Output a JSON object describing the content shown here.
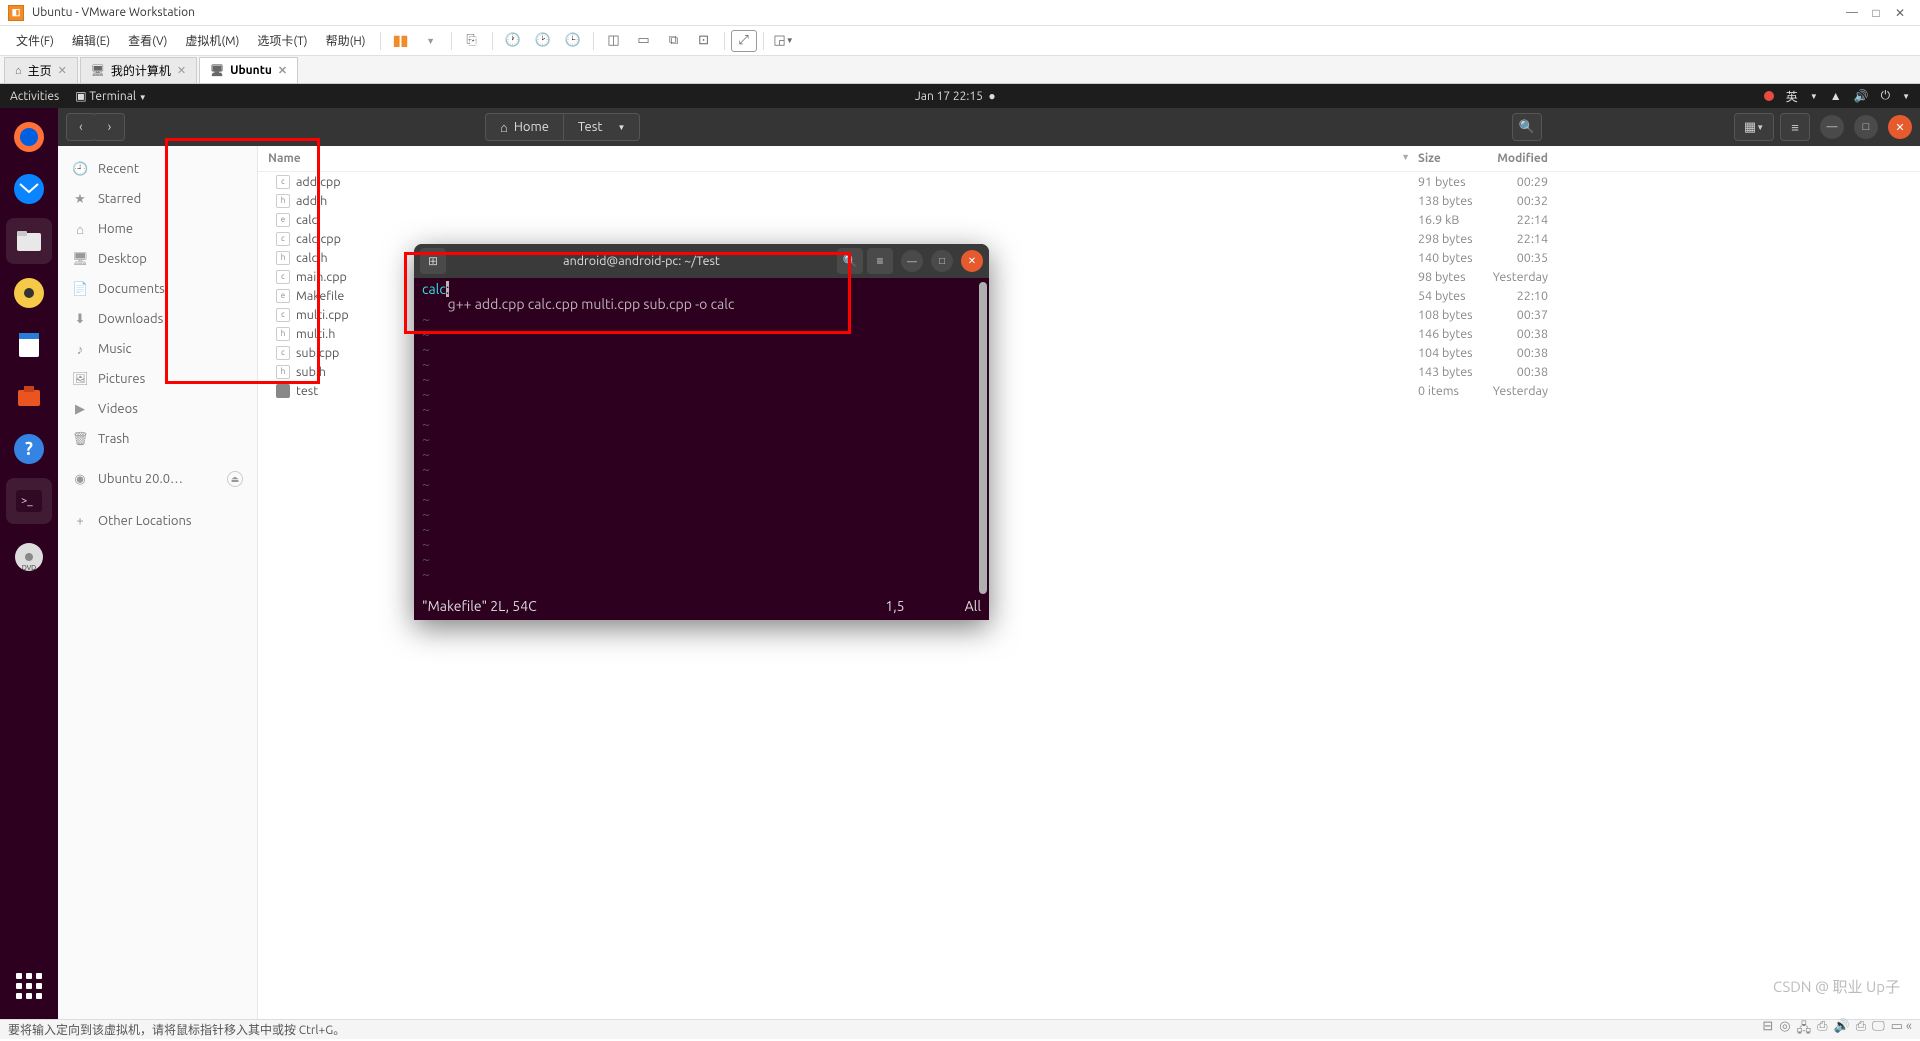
{
  "host": {
    "title": "Ubuntu - VMware Workstation",
    "menu": [
      "文件(F)",
      "编辑(E)",
      "查看(V)",
      "虚拟机(M)",
      "选项卡(T)",
      "帮助(H)"
    ],
    "tabs": [
      {
        "label": "主页",
        "icon": "⌂"
      },
      {
        "label": "我的计算机",
        "icon": "🖥"
      },
      {
        "label": "Ubuntu",
        "icon": "🖥",
        "active": true
      }
    ],
    "status": "要将输入定向到该虚拟机，请将鼠标指针移入其中或按 Ctrl+G。"
  },
  "ubuntu_panel": {
    "activities": "Activities",
    "terminal_menu": "Terminal",
    "datetime": "Jan 17  22:15",
    "lang": "英"
  },
  "files": {
    "path": [
      {
        "label": "Home",
        "icon": "⌂"
      },
      {
        "label": "Test",
        "dropdown": true
      }
    ],
    "sidebar": [
      {
        "label": "Recent",
        "icon": "🕘"
      },
      {
        "label": "Starred",
        "icon": "★"
      },
      {
        "label": "Home",
        "icon": "⌂"
      },
      {
        "label": "Desktop",
        "icon": "🖥"
      },
      {
        "label": "Documents",
        "icon": "📄"
      },
      {
        "label": "Downloads",
        "icon": "⬇"
      },
      {
        "label": "Music",
        "icon": "♪"
      },
      {
        "label": "Pictures",
        "icon": "🖼"
      },
      {
        "label": "Videos",
        "icon": "▶"
      },
      {
        "label": "Trash",
        "icon": "🗑"
      },
      {
        "label": "Ubuntu 20.0…",
        "icon": "◉",
        "eject": true
      },
      {
        "label": "Other Locations",
        "icon": "+"
      }
    ],
    "columns": {
      "name": "Name",
      "size": "Size",
      "modified": "Modified"
    },
    "rows": [
      {
        "name": "add.cpp",
        "type": "c",
        "size": "91 bytes",
        "modified": "00:29"
      },
      {
        "name": "add.h",
        "type": "h",
        "size": "138 bytes",
        "modified": "00:32"
      },
      {
        "name": "calc",
        "type": "e",
        "size": "16.9 kB",
        "modified": "22:14"
      },
      {
        "name": "calc.cpp",
        "type": "c",
        "size": "298 bytes",
        "modified": "22:14"
      },
      {
        "name": "calc.h",
        "type": "h",
        "size": "140 bytes",
        "modified": "00:35"
      },
      {
        "name": "main.cpp",
        "type": "c",
        "size": "98 bytes",
        "modified": "Yesterday"
      },
      {
        "name": "Makefile",
        "type": "e",
        "size": "54 bytes",
        "modified": "22:10"
      },
      {
        "name": "multi.cpp",
        "type": "c",
        "size": "108 bytes",
        "modified": "00:37"
      },
      {
        "name": "multi.h",
        "type": "h",
        "size": "146 bytes",
        "modified": "00:38"
      },
      {
        "name": "sub.cpp",
        "type": "c",
        "size": "104 bytes",
        "modified": "00:38"
      },
      {
        "name": "sub.h",
        "type": "h",
        "size": "143 bytes",
        "modified": "00:38"
      },
      {
        "name": "test",
        "type": "folder",
        "size": "0 items",
        "modified": "Yesterday"
      }
    ]
  },
  "terminal": {
    "title": "android@android-pc: ~/Test",
    "line1_target": "calc",
    "line1_cursor": ":",
    "line2": "        g++ add.cpp calc.cpp multi.cpp sub.cpp -o calc",
    "status_file": "\"Makefile\" 2L, 54C",
    "status_pos": "1,5",
    "status_pct": "All"
  },
  "watermark": "CSDN @ 职业 Up子"
}
